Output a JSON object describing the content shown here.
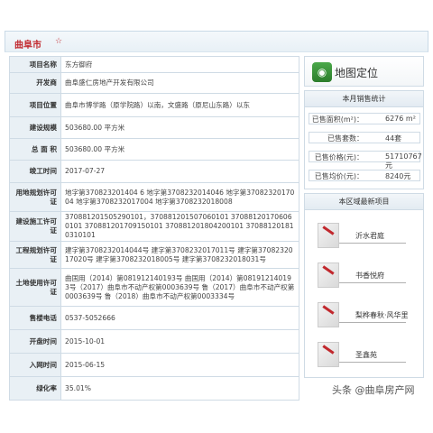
{
  "header": {
    "title": "曲阜市",
    "star": "☆"
  },
  "project": {
    "rows": [
      {
        "label": "项目名称",
        "value": "东方御府"
      },
      {
        "label": "开发商",
        "value": "曲阜盛仁房地产开发有限公司"
      },
      {
        "label": "项目位置",
        "value": "曲阜市博学路（原学院路）以南，文盛路（原尼山东路）以东"
      },
      {
        "label": "建设规模",
        "value": "503680.00 平方米"
      },
      {
        "label": "总 面 积",
        "value": "503680.00 平方米"
      },
      {
        "label": "竣工时间",
        "value": "2017-07-27"
      },
      {
        "label": "用地规划许可证",
        "value": "地字第370823201404 6 地字第3708232014046 地字第3708232017004 地字第3708232017004 地字第3708232018008"
      },
      {
        "label": "建设施工许可证",
        "value": "370881201505290101，370881201507060101 370881201706060101 370881201709150101 370881201804200101 370881201810310101"
      },
      {
        "label": "工程规划许可证",
        "value": "建字第3708232014044号 建字第3708232017011号 建字第3708232017020号 建字第3708232018005号 建字第3708232018031号"
      },
      {
        "label": "土地使用许可证",
        "value": "曲国用（2014）第081912140193号 曲国用（2014）第081912140193号（2017）曲阜市不动产权第0003639号 鲁（2017）曲阜市不动产权第0003639号 鲁（2018）曲阜市不动产权第0003334号"
      },
      {
        "label": "售楼电话",
        "value": "0537-5052666"
      },
      {
        "label": "开盘时间",
        "value": "2015-10-01"
      },
      {
        "label": "入网时间",
        "value": "2015-06-15"
      },
      {
        "label": "绿化率",
        "value": "35.01%"
      }
    ]
  },
  "map_button": {
    "label": "地图定位",
    "icon": "map-icon"
  },
  "monthly_stats": {
    "title": "本月销售统计",
    "rows": [
      {
        "label": "已售面积(m²)：",
        "value": "6276 m²"
      },
      {
        "label": "已售套数：",
        "value": "44套"
      },
      {
        "label": "已售价格(元)：",
        "value": "51710767元"
      },
      {
        "label": "已售均价(元)：",
        "value": "8240元"
      }
    ]
  },
  "nearby": {
    "title": "本区域最新项目",
    "items": [
      {
        "name": "沂水君庭"
      },
      {
        "name": "书香悦府"
      },
      {
        "name": "梨桦春秋·风华里"
      },
      {
        "name": "圣鑫苑"
      }
    ]
  },
  "watermark": {
    "text": "头条 @曲阜房产网"
  }
}
